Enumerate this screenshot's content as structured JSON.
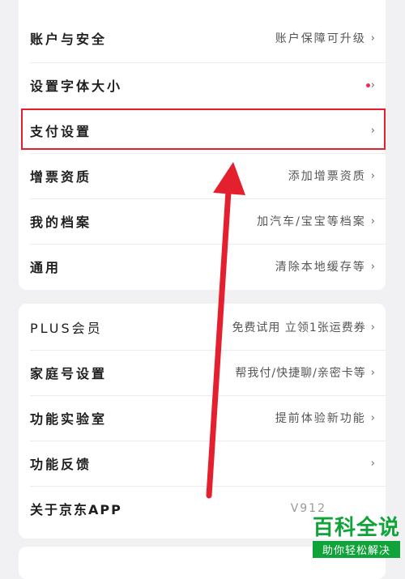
{
  "section1": {
    "rows": [
      {
        "label": "账户与安全",
        "value": "账户保障可升级"
      },
      {
        "label": "设置字体大小",
        "value": ""
      },
      {
        "label": "支付设置",
        "value": ""
      },
      {
        "label": "增票资质",
        "value": "添加增票资质"
      },
      {
        "label": "我的档案",
        "value": "加汽车/宝宝等档案"
      },
      {
        "label": "通用",
        "value": "清除本地缓存等"
      }
    ]
  },
  "section2": {
    "rows": [
      {
        "label": "PLUS会员",
        "value": "免费试用 立领1张运费券"
      },
      {
        "label": "家庭号设置",
        "value": "帮我付/快捷聊/亲密卡等"
      },
      {
        "label": "功能实验室",
        "value": "提前体验新功能"
      },
      {
        "label": "功能反馈",
        "value": ""
      },
      {
        "label": "关于京东APP",
        "value": "V912"
      }
    ]
  },
  "icons": {
    "chevron": "›",
    "chevron_name": "chevron-right-icon",
    "dot_color": "#e8324a"
  },
  "annotation": {
    "highlight_color": "#e5202e"
  },
  "watermark": {
    "title": "百科全说",
    "subtitle": "助你轻松解决"
  }
}
